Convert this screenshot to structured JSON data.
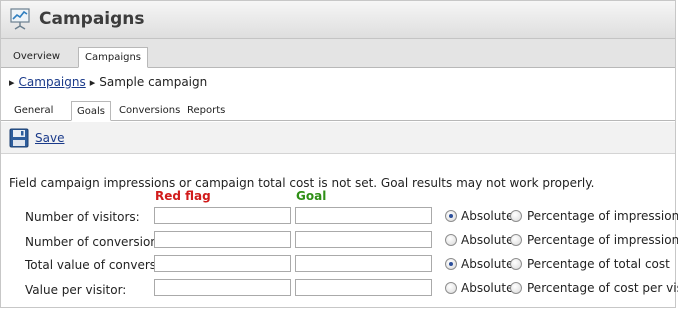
{
  "header": {
    "title": "Campaigns",
    "icon": "campaign-presentation-icon"
  },
  "main_tabs": [
    {
      "label": "Overview",
      "active": false
    },
    {
      "label": "Campaigns",
      "active": true
    }
  ],
  "breadcrumb": {
    "parent": "Campaigns",
    "current": "Sample campaign"
  },
  "sub_tabs": [
    {
      "label": "General",
      "active": false
    },
    {
      "label": "Goals",
      "active": true
    },
    {
      "label": "Conversions",
      "active": false
    },
    {
      "label": "Reports",
      "active": false
    }
  ],
  "toolbar": {
    "save_label": "Save",
    "save_icon": "floppy-disk-icon"
  },
  "goals": {
    "warning": "Field campaign impressions or campaign total cost is not set. Goal results may not work properly.",
    "red_flag_header": "Red flag",
    "goal_header": "Goal",
    "rows": [
      {
        "label": "Number of visitors:",
        "red_flag_value": "",
        "goal_value": "",
        "option_absolute": "Absolute",
        "option_percentage": "Percentage of impressions",
        "selected": "absolute"
      },
      {
        "label": "Number of conversions:",
        "red_flag_value": "",
        "goal_value": "",
        "option_absolute": "Absolute",
        "option_percentage": "Percentage of impressions",
        "selected": "none"
      },
      {
        "label": "Total value of conversions:",
        "red_flag_value": "",
        "goal_value": "",
        "option_absolute": "Absolute",
        "option_percentage": "Percentage of total cost",
        "selected": "absolute"
      },
      {
        "label": "Value per visitor:",
        "red_flag_value": "",
        "goal_value": "",
        "option_absolute": "Absolute",
        "option_percentage": "Percentage of cost per visitor",
        "selected": "none"
      }
    ]
  },
  "colors": {
    "red_flag": "#d11b1b",
    "goal": "#2f8f16",
    "link": "#1a3a8a"
  }
}
